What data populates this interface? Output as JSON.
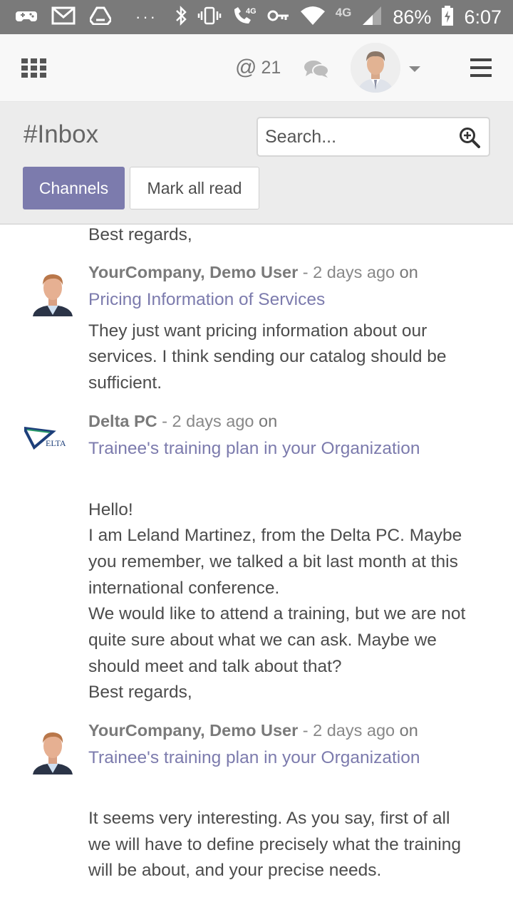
{
  "status_bar": {
    "network": "4G",
    "network2": "4G",
    "battery": "86%",
    "time": "6:07"
  },
  "topbar": {
    "mention_symbol": "@",
    "mention_count": "21"
  },
  "control_panel": {
    "title": "#Inbox",
    "search_placeholder": "Search...",
    "channels_label": "Channels",
    "mark_all_read_label": "Mark all read"
  },
  "thread": {
    "prev_tail": "Best regards,",
    "messages": [
      {
        "author": "YourCompany, Demo User",
        "separator": "-",
        "date": "2 days ago",
        "on": "on",
        "record": "Pricing Information of Services",
        "body": [
          "They just want pricing information about our",
          "services. I think sending our catalog should be",
          "sufficient."
        ]
      },
      {
        "author": "Delta PC",
        "separator": "-",
        "date": "2 days ago",
        "on": "on",
        "record": "Trainee's training plan in your Organization",
        "logo_text": "ELTA",
        "body": [
          "Hello!",
          "I am Leland Martinez, from the Delta PC. Maybe",
          "you remember, we talked a bit last month at this",
          "international conference.",
          "We would like to attend a training, but we are not",
          "quite sure about what we can ask. Maybe we",
          "should meet and talk about that?",
          "Best regards,"
        ]
      },
      {
        "author": "YourCompany, Demo User",
        "separator": "-",
        "date": "2 days ago",
        "on": "on",
        "record": "Trainee's training plan in your Organization",
        "body": [
          "It seems very interesting. As you say, first of all",
          "we will have to define precisely what the training",
          "will be about, and your precise needs."
        ]
      }
    ]
  },
  "colors": {
    "accent": "#7c7bad",
    "status_bar": "#7a7a7a",
    "control_panel_bg": "#ececec"
  }
}
